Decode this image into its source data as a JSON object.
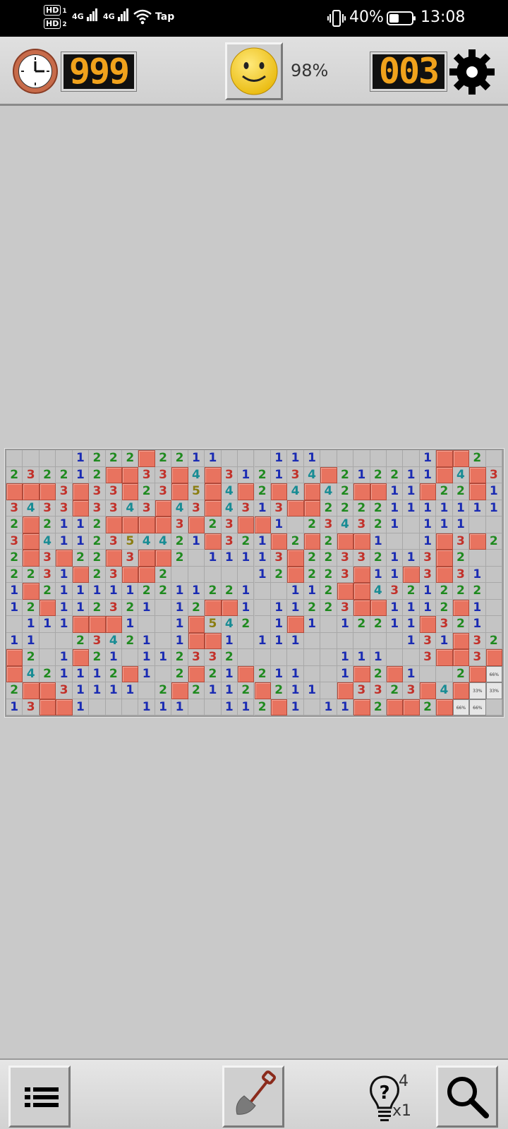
{
  "status_bar": {
    "sim1": "HD",
    "sim1_index": "1",
    "sim2": "HD",
    "sim2_index": "2",
    "net1": "4G",
    "net2": "4G",
    "wifi_label": "Tap",
    "battery_percent": "40%",
    "time": "13:08"
  },
  "toolbar": {
    "timer_value": "999",
    "face_state": "smiley",
    "progress_percent": "98%",
    "mines_remaining": "003",
    "clock_icon": "clock-icon",
    "settings_icon": "gear-icon"
  },
  "board": {
    "cols": 30,
    "rows": 16,
    "legend": "0=empty revealed, 1-8=number, F=flag, H=hidden",
    "grid": [
      "00001222F22110001110000001FF20",
      "232212FF33F4F312134F212211F4F31",
      "FFF3F33F23F5F4F2F4F42FF11F22F1",
      "3433F3343F43F4313FF22221111111",
      "2F2112FFFF3F23FF1023432101110",
      "3F4112354421F321F2F2FF1001F3F2",
      "2F3F22F3FF2011113F22332113F2",
      "2231F23FF20000012F223F11F3F31",
      "1F211111221122100112FF4321222",
      "12F112321012FF1011223FF1112F1",
      "0111FFF1001F54201F1012211F321",
      "11002342101FF10111000000131F321",
      "F201F210112332000000111003FF3F",
      "F421112F102F21F211001F2F1002FHHH",
      "2FF3111102F2112F2110F3323F4FHH",
      "13FF100011100112F1011F2FF2FHH"
    ],
    "hints": [
      "66%",
      "33%",
      "33%",
      "66%",
      "66%"
    ]
  },
  "bottom_bar": {
    "menu_icon": "list-icon",
    "dig_icon": "shovel-icon",
    "hint_icon": "lightbulb-icon",
    "hint_count": "4",
    "hint_multiplier": "x1",
    "zoom_icon": "magnifier-icon"
  }
}
